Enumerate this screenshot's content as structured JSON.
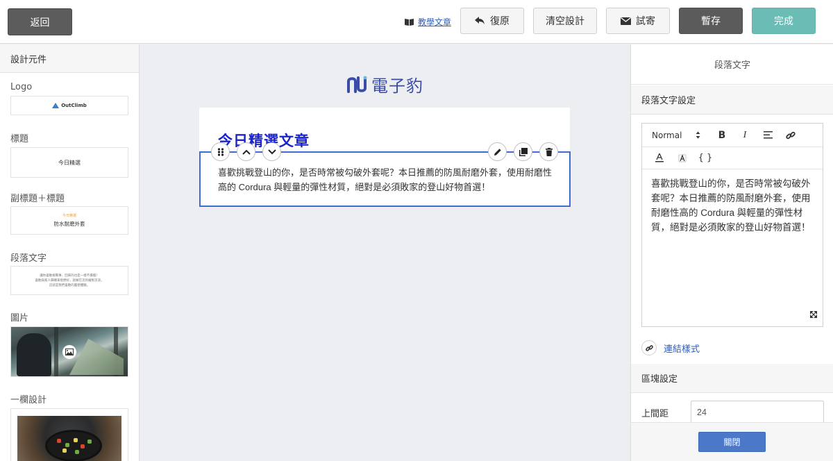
{
  "topbar": {
    "back_label": "返回",
    "tutorial_label": "教學文章",
    "undo_label": "復原",
    "clear_label": "清空設計",
    "test_send_label": "試寄",
    "save_label": "暫存",
    "done_label": "完成"
  },
  "sidebar": {
    "header": "設計元件",
    "components": [
      {
        "label": "Logo",
        "preview_text": "OutClimb"
      },
      {
        "label": "標題",
        "preview_text": "今日精選"
      },
      {
        "label": "副標題＋標題",
        "preview_sub": "今日精選",
        "preview_text": "防水耐磨外套"
      },
      {
        "label": "段落文字",
        "preview_lines": [
          "讓你喜歡挑戰事，回來的也是一樣不擔擔！",
          "喜歡與家人歸鄉來接野好，就擁在流的繪製流浪，",
          "這就是我們喜歡的露營體驗。"
        ]
      },
      {
        "label": "圖片"
      },
      {
        "label": "一欄設計"
      }
    ]
  },
  "canvas": {
    "brand_text": "電子豹",
    "heading": "今日精選文章",
    "paragraph": "喜歡挑戰登山的你，是否時常被勾破外套呢？本日推薦的防風耐磨外套，使用耐磨性高的 Cordura 與輕量的彈性材質，絕對是必須敗家的登山好物首選！"
  },
  "panel": {
    "title": "段落文字",
    "text_settings_header": "段落文字設定",
    "editor": {
      "format_value": "Normal",
      "bold": "B",
      "italic": "I",
      "code": "{ }",
      "body": "喜歡挑戰登山的你，是否時常被勾破外套呢？本日推薦的防風耐磨外套，使用耐磨性高的 Cordura 與輕量的彈性材質，絕對是必須敗家的登山好物首選！"
    },
    "link_style_label": "連結樣式",
    "block_settings_header": "區塊設定",
    "top_margin_label": "上間距",
    "top_margin_value": "24",
    "close_label": "關閉"
  },
  "colors": {
    "accent_blue": "#3c6cd4",
    "heading_blue": "#1b24c8",
    "brand_purple": "#3a4ba8",
    "done_teal": "#6cbcb6",
    "dark_button": "#5b5b5b",
    "close_blue": "#4b79c8"
  }
}
